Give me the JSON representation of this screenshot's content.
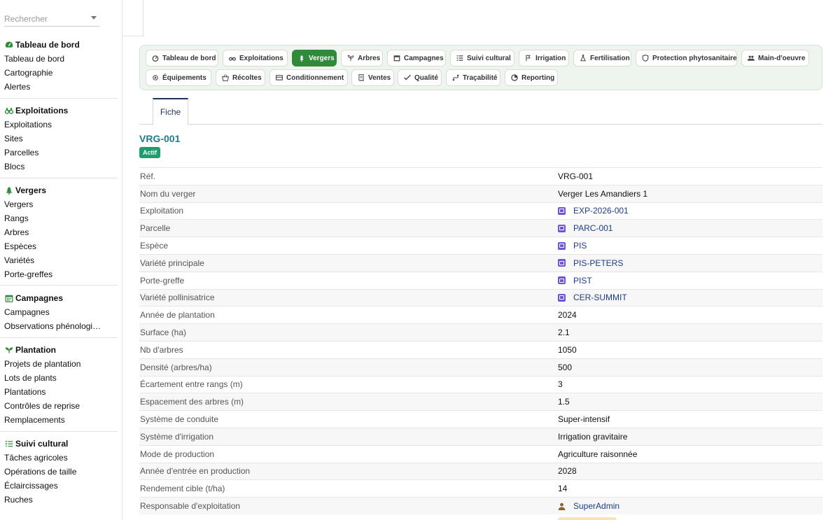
{
  "search": {
    "placeholder": "Rechercher"
  },
  "sidebar": {
    "sections": [
      {
        "title": "Tableau de bord",
        "icon": "gauge-icon",
        "items": [
          "Tableau de bord",
          "Cartographie",
          "Alertes"
        ]
      },
      {
        "title": "Exploitations",
        "icon": "binoculars-icon",
        "items": [
          "Exploitations",
          "Sites",
          "Parcelles",
          "Blocs"
        ]
      },
      {
        "title": "Vergers",
        "icon": "tree-icon",
        "items": [
          "Vergers",
          "Rangs",
          "Arbres",
          "Espèces",
          "Variétés",
          "Porte-greffes"
        ]
      },
      {
        "title": "Campagnes",
        "icon": "calendar-icon",
        "items": [
          "Campagnes",
          "Observations phénologiq…"
        ]
      },
      {
        "title": "Plantation",
        "icon": "seedling-icon",
        "items": [
          "Projets de plantation",
          "Lots de plants",
          "Plantations",
          "Contrôles de reprise",
          "Remplacements"
        ]
      },
      {
        "title": "Suivi cultural",
        "icon": "list-icon",
        "items": [
          "Tâches agricoles",
          "Opérations de taille",
          "Éclaircissages",
          "Ruches"
        ]
      }
    ]
  },
  "modules": [
    "Tableau de bord",
    "Exploitations",
    "Vergers",
    "Arbres",
    "Campagnes",
    "Suivi cultural",
    "Irrigation",
    "Fertilisation",
    "Protection phytosanitaire",
    "Main-d'oeuvre",
    "Équipements",
    "Récoltes",
    "Conditionnement",
    "Ventes",
    "Qualité",
    "Traçabilité",
    "Reporting"
  ],
  "active_module": "Vergers",
  "tab": {
    "label": "Fiche"
  },
  "record": {
    "title": "VRG-001",
    "status": "Actif"
  },
  "fields": [
    {
      "label": "Réf.",
      "value": "VRG-001",
      "kind": "text"
    },
    {
      "label": "Nom du verger",
      "value": "Verger Les Amandiers 1",
      "kind": "text"
    },
    {
      "label": "Exploitation",
      "value": "EXP-2026-001",
      "kind": "link"
    },
    {
      "label": "Parcelle",
      "value": "PARC-001",
      "kind": "link"
    },
    {
      "label": "Espèce",
      "value": "PIS",
      "kind": "link"
    },
    {
      "label": "Variété principale",
      "value": "PIS-PETERS",
      "kind": "link"
    },
    {
      "label": "Porte-greffe",
      "value": "PIST",
      "kind": "link"
    },
    {
      "label": "Variété pollinisatrice",
      "value": "CER-SUMMIT",
      "kind": "link"
    },
    {
      "label": "Année de plantation",
      "value": "2024",
      "kind": "text"
    },
    {
      "label": "Surface (ha)",
      "value": "2.1",
      "kind": "text"
    },
    {
      "label": "Nb d'arbres",
      "value": "1050",
      "kind": "text"
    },
    {
      "label": "Densité (arbres/ha)",
      "value": "500",
      "kind": "text"
    },
    {
      "label": "Écartement entre rangs (m)",
      "value": "3",
      "kind": "text"
    },
    {
      "label": "Espacement des arbres (m)",
      "value": "1.5",
      "kind": "text"
    },
    {
      "label": "Système de conduite",
      "value": "Super-intensif",
      "kind": "text"
    },
    {
      "label": "Système d'irrigation",
      "value": "Irrigation gravitaire",
      "kind": "text"
    },
    {
      "label": "Mode de production",
      "value": "Agriculture raisonnée",
      "kind": "text"
    },
    {
      "label": "Année d'entrée en production",
      "value": "2028",
      "kind": "text"
    },
    {
      "label": "Rendement cible (t/ha)",
      "value": "14",
      "kind": "text"
    },
    {
      "label": "Responsable d'exploitation",
      "value": "SuperAdmin",
      "kind": "user"
    }
  ],
  "colors": {
    "accent": "#2f8a3a",
    "title": "#1a7f8c",
    "badge": "#1e9e6e",
    "link": "#1d3b8a",
    "record_icon": "#6f55d6"
  }
}
